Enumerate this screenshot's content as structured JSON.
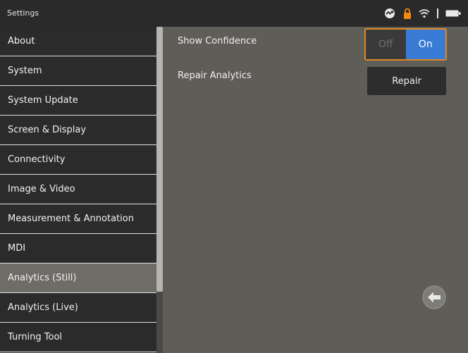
{
  "titlebar": {
    "title": "Settings"
  },
  "status_icons": [
    "sync-icon",
    "lock-icon",
    "wifi-icon",
    "battery-icon"
  ],
  "sidebar": {
    "items": [
      {
        "label": "About"
      },
      {
        "label": "System"
      },
      {
        "label": "System Update"
      },
      {
        "label": "Screen & Display"
      },
      {
        "label": "Connectivity"
      },
      {
        "label": "Image & Video"
      },
      {
        "label": "Measurement & Annotation"
      },
      {
        "label": "MDI"
      },
      {
        "label": "Analytics (Still)",
        "selected": true
      },
      {
        "label": "Analytics (Live)"
      },
      {
        "label": "Turning Tool"
      }
    ]
  },
  "content": {
    "show_confidence": {
      "label": "Show Confidence",
      "off_label": "Off",
      "on_label": "On",
      "value": "On"
    },
    "repair_analytics": {
      "label": "Repair Analytics",
      "button_label": "Repair"
    }
  },
  "colors": {
    "accent": "#3a7bd5",
    "focus": "#e08a1e",
    "background": "#5f5d58",
    "sidebar": "#2b2b2b"
  }
}
